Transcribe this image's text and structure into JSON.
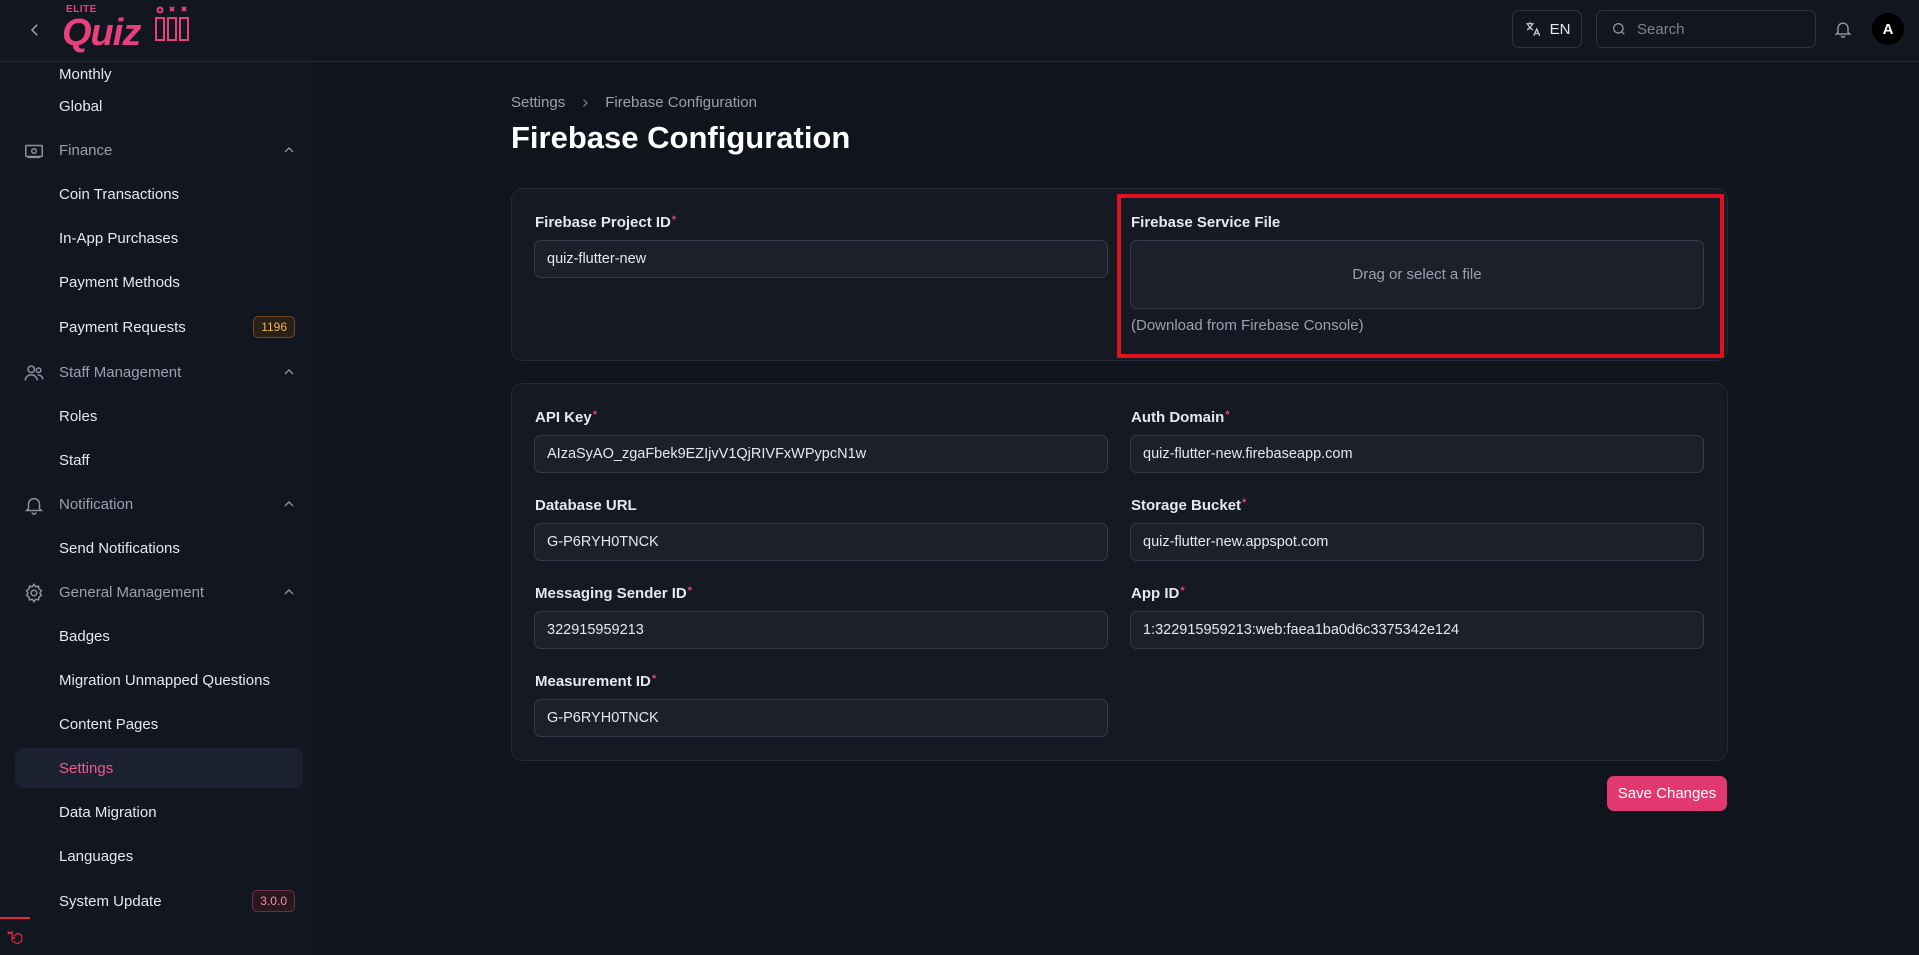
{
  "header": {
    "logo_top_text": "ELITE",
    "logo_text": "Quiz",
    "language_label": "EN",
    "search_placeholder": "Search",
    "avatar_initial": "A"
  },
  "sidebar": {
    "items": [
      {
        "label": "Monthly"
      },
      {
        "label": "Global"
      },
      {
        "label": "Finance",
        "group": true
      },
      {
        "label": "Coin Transactions"
      },
      {
        "label": "In-App Purchases"
      },
      {
        "label": "Payment Methods"
      },
      {
        "label": "Payment Requests",
        "badge": "1196"
      },
      {
        "label": "Staff Management",
        "group": true
      },
      {
        "label": "Roles"
      },
      {
        "label": "Staff"
      },
      {
        "label": "Notification",
        "group": true
      },
      {
        "label": "Send Notifications"
      },
      {
        "label": "General Management",
        "group": true
      },
      {
        "label": "Badges"
      },
      {
        "label": "Migration Unmapped Questions"
      },
      {
        "label": "Content Pages"
      },
      {
        "label": "Settings",
        "active": true
      },
      {
        "label": "Data Migration"
      },
      {
        "label": "Languages"
      },
      {
        "label": "System Update",
        "badge": "3.0.0"
      }
    ]
  },
  "breadcrumb": {
    "parent": "Settings",
    "current": "Firebase Configuration"
  },
  "page_title": "Firebase Configuration",
  "form": {
    "project_id": {
      "label": "Firebase Project ID",
      "value": "quiz-flutter-new"
    },
    "service_file": {
      "label": "Firebase Service File",
      "dropzone_text": "Drag or select a file",
      "helper": "(Download from Firebase Console)"
    },
    "api_key": {
      "label": "API Key",
      "value": "AIzaSyAO_zgaFbek9EZIjvV1QjRIVFxWPypcN1w"
    },
    "auth_domain": {
      "label": "Auth Domain",
      "value": "quiz-flutter-new.firebaseapp.com"
    },
    "database_url": {
      "label": "Database URL",
      "value": "G-P6RYH0TNCK"
    },
    "storage_bucket": {
      "label": "Storage Bucket",
      "value": "quiz-flutter-new.appspot.com"
    },
    "messaging_sender_id": {
      "label": "Messaging Sender ID",
      "value": "322915959213"
    },
    "app_id": {
      "label": "App ID",
      "value": "1:322915959213:web:faea1ba0d6c3375342e124"
    },
    "measurement_id": {
      "label": "Measurement ID",
      "value": "G-P6RYH0TNCK"
    },
    "required_mark": "*"
  },
  "actions": {
    "save_label": "Save Changes"
  },
  "colors": {
    "accent": "#e0386f",
    "highlight": "#e0101e"
  }
}
